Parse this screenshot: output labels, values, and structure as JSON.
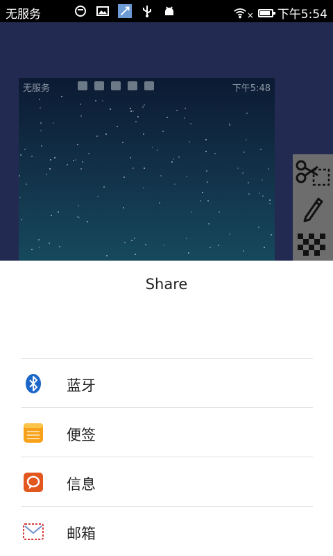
{
  "status_bar": {
    "carrier": "无服务",
    "time": "下午5:54"
  },
  "preview": {
    "carrier": "无服务",
    "time": "下午5:48"
  },
  "toolbar": {
    "tools": [
      "crop-icon",
      "pencil-icon",
      "mosaic-icon"
    ]
  },
  "share": {
    "title": "Share",
    "items": [
      {
        "label": "蓝牙",
        "icon": "bluetooth-icon",
        "color": "#1b66c9"
      },
      {
        "label": "便签",
        "icon": "notes-icon",
        "color": "#f7a21a"
      },
      {
        "label": "信息",
        "icon": "messages-icon",
        "color": "#e2571e"
      },
      {
        "label": "邮箱",
        "icon": "mail-icon",
        "color": "#d33b3b"
      }
    ]
  }
}
